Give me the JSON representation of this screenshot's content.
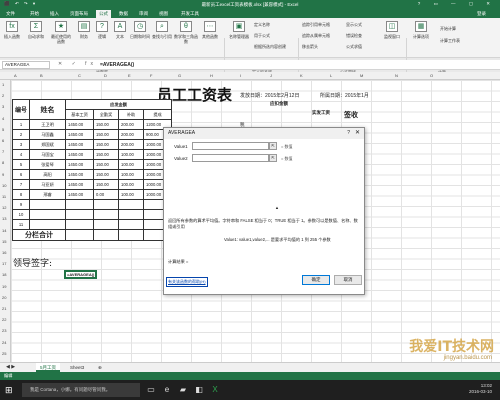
{
  "window": {
    "title": "最新员工excel工资表模板.xlsx [兼容模式] - Excel",
    "quick_access": "⬛ ↶ ↷ ▾",
    "controls": "? ▭ — ▢ ✕"
  },
  "tabs": [
    "文件",
    "开始",
    "插入",
    "页面布局",
    "公式",
    "数据",
    "审阅",
    "视图",
    "开发工具",
    "登录"
  ],
  "ribbon": {
    "insert_fn": "插入函数",
    "autosum": "自动求和",
    "recent": "最近使用的函数",
    "financial": "财务",
    "logical": "逻辑",
    "text": "文本",
    "datetime": "日期和时间",
    "lookup": "查找与引用",
    "math": "数学和三角函数",
    "other": "其他函数",
    "name_mgr": "名称管理器",
    "define_name": "定义名称",
    "use_in_formula": "用于公式",
    "create_from_sel": "根据所选内容创建",
    "trace_prec": "追踪引用单元格",
    "trace_dep": "追踪从属单元格",
    "remove_arrows": "移去箭头",
    "show_formulas": "显示公式",
    "error_check": "错误检查",
    "eval_formula": "公式求值",
    "watch": "监视窗口",
    "calc_opts": "计算选项",
    "calc_now": "开始计算",
    "calc_sheet": "计算工作表",
    "grp_lib": "函数库",
    "grp_names": "定义的名称",
    "grp_audit": "公式审核",
    "grp_calc": "计算"
  },
  "formula_bar": {
    "name_box": "AVERAGEA",
    "fx": "✕ ✓ fx",
    "formula": "=AVERAGEA()"
  },
  "columns": [
    "A",
    "B",
    "C",
    "D",
    "E",
    "F",
    "G",
    "H",
    "I",
    "J",
    "K",
    "L",
    "M",
    "N",
    "O"
  ],
  "rows": [
    "1",
    "2",
    "3",
    "4",
    "5",
    "6",
    "7",
    "8",
    "9",
    "10",
    "11",
    "12",
    "13",
    "14",
    "15",
    "16",
    "17",
    "18",
    "19",
    "20",
    "21",
    "22",
    "23",
    "24",
    "25"
  ],
  "sheet": {
    "title": "员工工资表",
    "pay_date_label": "发放日期：2015年2月12日",
    "period": "所属日期：2015年1月",
    "hdr_no": "编号",
    "hdr_name": "姓名",
    "hdr_payable": "应发金额",
    "hdr_deduct": "应扣金额",
    "hdr_actual": "实发工资",
    "hdr_sign": "签收",
    "hdr_base": "基本工资",
    "hdr_allow": "全勤奖",
    "hdr_sub": "补助",
    "hdr_bonus": "提成",
    "hdr_tax": "税",
    "rows": [
      {
        "no": "1",
        "name": "王卫明",
        "base": "1450.00",
        "allow": "150.00",
        "sub": "200.00",
        "bonus": "1200.00"
      },
      {
        "no": "2",
        "name": "马国鑫",
        "base": "1450.00",
        "allow": "150.00",
        "sub": "200.00",
        "bonus": "900.00"
      },
      {
        "no": "3",
        "name": "郑国斌",
        "base": "1450.00",
        "allow": "150.00",
        "sub": "200.00",
        "bonus": "1000.00"
      },
      {
        "no": "4",
        "name": "马国宝",
        "base": "1450.00",
        "allow": "150.00",
        "sub": "100.00",
        "bonus": "1000.00"
      },
      {
        "no": "5",
        "name": "张爱琴",
        "base": "1450.00",
        "allow": "150.00",
        "sub": "100.00",
        "bonus": "1000.00"
      },
      {
        "no": "6",
        "name": "高阳",
        "base": "1450.00",
        "allow": "150.00",
        "sub": "100.00",
        "bonus": "1000.00"
      },
      {
        "no": "7",
        "name": "马亚妍",
        "base": "1450.00",
        "allow": "150.00",
        "sub": "100.00",
        "bonus": "1000.00"
      },
      {
        "no": "8",
        "name": "邢睿",
        "base": "1450.00",
        "allow": "0.00",
        "sub": "100.00",
        "bonus": "1000.00"
      },
      {
        "no": "9",
        "name": "",
        "base": "",
        "allow": "",
        "sub": "",
        "bonus": ""
      },
      {
        "no": "10",
        "name": "",
        "base": "",
        "allow": "",
        "sub": "",
        "bonus": ""
      },
      {
        "no": "11",
        "name": "",
        "base": "",
        "allow": "",
        "sub": "",
        "bonus": ""
      }
    ],
    "subtotal": "分栏合计",
    "sign_label": "领导签字:",
    "edit_cell": "=AVERAGEA()"
  },
  "dialog": {
    "title": "AVERAGEA",
    "value1_label": "Value1",
    "value2_label": "Value2",
    "ref_btn": "⇱",
    "num_hint": "= 数值",
    "scroll": "▲",
    "description": "返回所有参数的算术平均值。字符串和 FALSE 相当于 0；TRUE 相当于 1。参数可以是数值、名称、数组或引用",
    "arg_help": "Value1:  value1,value2,... 是要求平均值的 1 到 255 个参数",
    "calc_result": "计算结果 =",
    "help_link": "有关该函数的帮助(H)",
    "ok": "确定",
    "cancel": "取消",
    "help_q": "?",
    "close_x": "✕"
  },
  "sheet_tabs": {
    "active": "5月工资",
    "other": "Sheet3",
    "add": "⊕"
  },
  "status": "编辑",
  "taskbar": {
    "start": "⊞",
    "search": "我是 Cortana，小娜。有问题尽管问我。",
    "time": "13:02",
    "date": "2016-03-10"
  },
  "watermark": {
    "main": "我爱IT技术网",
    "sub": "jingyan.baidu.com"
  }
}
